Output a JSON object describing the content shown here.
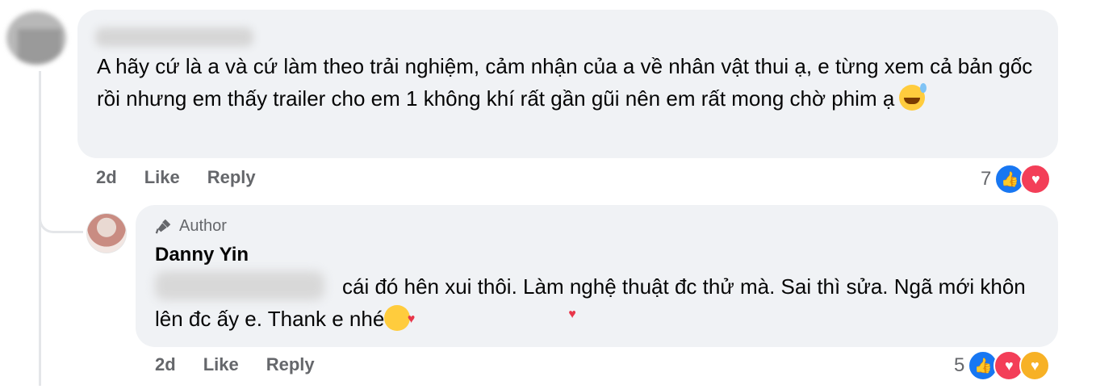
{
  "comment": {
    "text": "A hãy cứ là a và cứ làm theo trải nghiệm, cảm nhận của a về nhân vật thui ạ, e từng xem cả bản gốc rồi nhưng em thấy trailer cho em 1 không khí rất gần gũi nên em rất mong chờ phim ạ",
    "emoji": "sweat-smile-emoji",
    "time": "2d",
    "like_label": "Like",
    "reply_label": "Reply",
    "reaction_count": "7",
    "reactions": [
      "like",
      "love"
    ]
  },
  "reply": {
    "badge": "Author",
    "author": "Danny Yin",
    "text": "cái đó hên xui thôi. Làm nghệ thuật đc thử mà. Sai thì sửa. Ngã mới khôn lên đc ấy e. Thank e nhé",
    "emoji": "smiling-face-with-hearts-emoji",
    "time": "2d",
    "like_label": "Like",
    "reply_label": "Reply",
    "reaction_count": "5",
    "reactions": [
      "like",
      "love",
      "care"
    ]
  },
  "colors": {
    "bubble": "#f0f2f5",
    "meta": "#65676b",
    "like": "#1877f2",
    "love": "#f33e58",
    "care": "#f7b125"
  }
}
